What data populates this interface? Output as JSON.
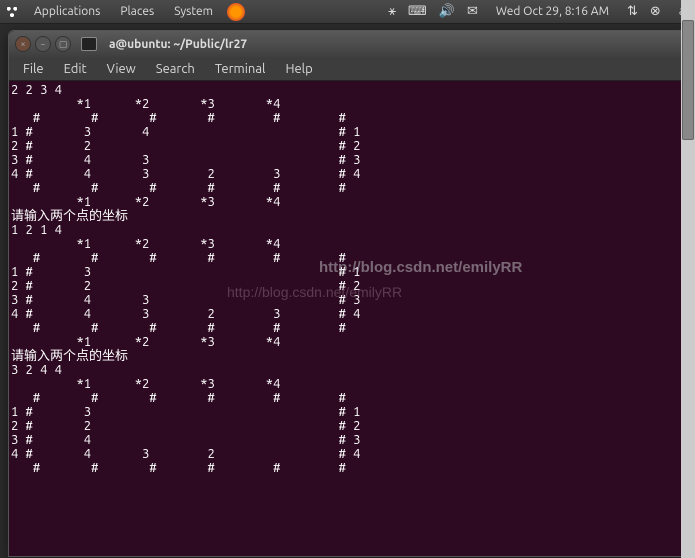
{
  "panel": {
    "applications": "Applications",
    "places": "Places",
    "system": "System",
    "datetime": "Wed Oct 29,  8:16 AM",
    "user": "a"
  },
  "window": {
    "title": "a@ubuntu: ~/Public/lr27"
  },
  "menubar": {
    "file": "File",
    "edit": "Edit",
    "view": "View",
    "search": "Search",
    "terminal": "Terminal",
    "help": "Help"
  },
  "terminal": {
    "lines": [
      "2 2 3 4",
      "         *1      *2       *3       *4",
      "   #       #       #       #        #        #",
      "1 #       3       4                          # 1",
      "2 #       2                                  # 2",
      "3 #       4       3                          # 3",
      "4 #       4       3        2        3        # 4",
      "   #       #       #       #        #        #",
      "         *1      *2       *3       *4",
      "请输入两个点的坐标",
      "1 2 1 4",
      "         *1      *2       *3       *4",
      "   #       #       #       #        #        #",
      "1 #       3                                  # 1",
      "2 #       2                                  # 2",
      "3 #       4       3                          # 3",
      "4 #       4       3        2        3        # 4",
      "   #       #       #       #        #        #",
      "         *1      *2       *3       *4",
      "请输入两个点的坐标",
      "3 2 4 4",
      "         *1      *2       *3       *4",
      "   #       #       #       #        #        #",
      "1 #       3                                  # 1",
      "2 #       2                                  # 2",
      "3 #       4                                  # 3",
      "4 #       4       3        2                 # 4",
      "   #       #       #       #        #        #"
    ]
  },
  "watermark": {
    "text1": "http://blog.csdn.net/emilyRR",
    "text2": "http://blog.csdn.net/emilyRR"
  }
}
